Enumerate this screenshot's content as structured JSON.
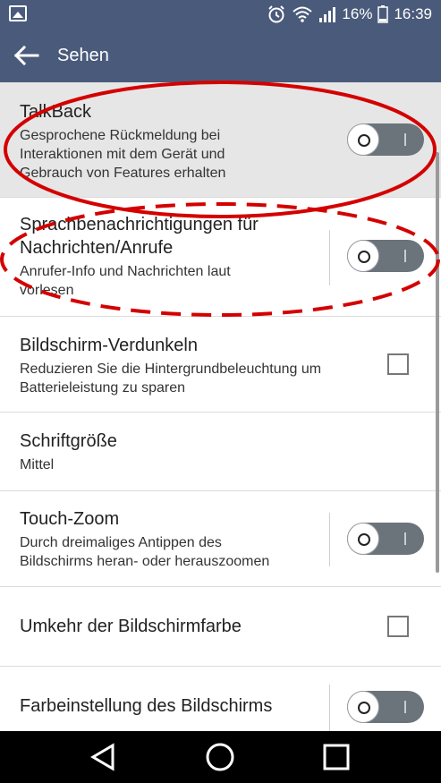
{
  "status_bar": {
    "battery_percent": "16%",
    "time": "16:39",
    "icons": [
      "gallery-icon",
      "alarm-icon",
      "wifi-icon",
      "signal-icon",
      "battery-icon"
    ]
  },
  "app_bar": {
    "title": "Sehen",
    "back_icon": "arrow-left-icon"
  },
  "settings": [
    {
      "title": "TalkBack",
      "subtitle_lines": [
        "Gesprochene Rückmeldung bei",
        "Interaktionen mit dem Gerät und",
        "Gebrauch von Features erhalten"
      ],
      "control": "toggle",
      "enabled": false,
      "highlighted": true
    },
    {
      "title_lines": [
        "Sprachbenachrichtigungen für",
        "Nachrichten/Anrufe"
      ],
      "subtitle_lines": [
        "Anrufer-Info und Nachrichten laut",
        "vorlesen"
      ],
      "control": "toggle",
      "enabled": false
    },
    {
      "title": "Bildschirm-Verdunkeln",
      "subtitle_lines": [
        "Reduzieren Sie die Hintergrundbeleuchtung um",
        "Batterieleistung zu sparen"
      ],
      "control": "checkbox",
      "checked": false
    },
    {
      "title": "Schriftgröße",
      "subtitle": "Mittel",
      "control": "none"
    },
    {
      "title": "Touch-Zoom",
      "subtitle_lines": [
        "Durch dreimaliges Antippen des",
        "Bildschirms heran- oder herauszoomen"
      ],
      "control": "toggle",
      "enabled": false
    },
    {
      "title": "Umkehr der Bildschirmfarbe",
      "control": "checkbox",
      "checked": false
    },
    {
      "title": "Farbeinstellung des Bildschirms",
      "control": "toggle",
      "enabled": false
    }
  ],
  "nav_bar": {
    "icons": [
      "back-triangle-icon",
      "home-circle-icon",
      "recents-square-icon"
    ]
  },
  "colors": {
    "app_bar": "#4a5a7a",
    "annotation": "#d40000",
    "toggle_off": "#6b737b"
  }
}
